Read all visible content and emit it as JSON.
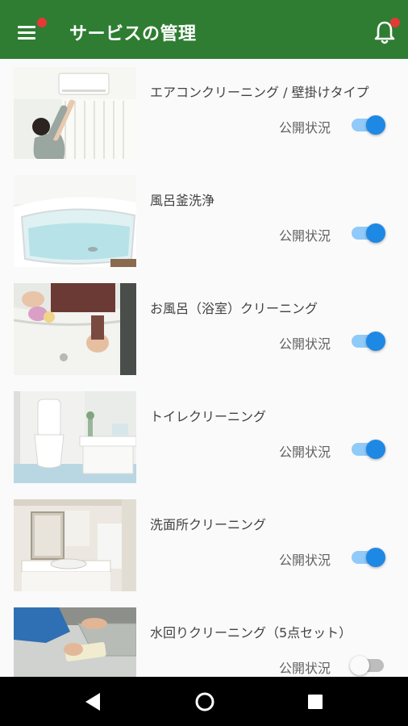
{
  "app_bar": {
    "title": "サービスの管理",
    "menu_icon": "hamburger-menu-icon",
    "notification_icon": "bell-icon",
    "badge_color": "#e53935",
    "background_color": "#2e7d32"
  },
  "services": [
    {
      "name": "エアコンクリーニング / 壁掛けタイプ",
      "status_label": "公開状況",
      "published": true,
      "image": "air-conditioner-cleaning-photo"
    },
    {
      "name": "風呂釜洗浄",
      "status_label": "公開状況",
      "published": true,
      "image": "bathtub-photo"
    },
    {
      "name": "お風呂（浴室）クリーニング",
      "status_label": "公開状況",
      "published": true,
      "image": "bathroom-cleaning-photo"
    },
    {
      "name": "トイレクリーニング",
      "status_label": "公開状況",
      "published": true,
      "image": "toilet-photo"
    },
    {
      "name": "洗面所クリーニング",
      "status_label": "公開状況",
      "published": true,
      "image": "washroom-photo"
    },
    {
      "name": "水回りクリーニング（5点セット）",
      "status_label": "公開状況",
      "published": false,
      "image": "kitchen-sink-cleaning-photo"
    }
  ],
  "nav_bar": {
    "back_icon": "back-triangle-icon",
    "home_icon": "home-circle-icon",
    "recents_icon": "recents-square-icon"
  },
  "colors": {
    "toggle_on": "#1e88e5",
    "toggle_on_track": "#90caf9",
    "toggle_off_track": "#bdbdbd"
  }
}
